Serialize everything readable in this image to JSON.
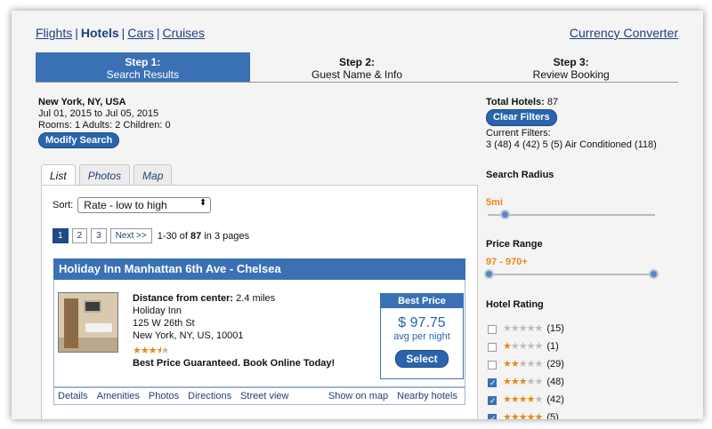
{
  "nav": {
    "flights": "Flights",
    "hotels": "Hotels",
    "cars": "Cars",
    "cruises": "Cruises",
    "separator": "|",
    "currency_converter": "Currency Converter"
  },
  "steps": [
    {
      "number": "Step 1:",
      "label": "Search Results"
    },
    {
      "number": "Step 2:",
      "label": "Guest Name & Info"
    },
    {
      "number": "Step 3:",
      "label": "Review Booking"
    }
  ],
  "search": {
    "city": "New York, NY, USA",
    "dates": "Jul 01, 2015 to Jul 05, 2015",
    "guests": "Rooms: 1 Adults: 2 Children: 0",
    "modify_label": "Modify Search"
  },
  "tabs": [
    "List",
    "Photos",
    "Map"
  ],
  "sort": {
    "label": "Sort:",
    "value": "Rate - low to high",
    "arrow": "⬍"
  },
  "pager": {
    "pages": [
      "1",
      "2",
      "3"
    ],
    "next_label": "Next >>",
    "summary_prefix": "1-30 of ",
    "total": "87",
    "summary_suffix": " in 3 pages"
  },
  "hotel": {
    "name": "Holiday Inn Manhattan 6th Ave - Chelsea",
    "distance_label": "Distance from center:",
    "distance_value": " 2.4 miles",
    "brand": "Holiday Inn",
    "street": "125 W 26th St",
    "citystate": "New York, NY, US, 10001",
    "stars": 3.5,
    "promo": "Best Price Guaranteed. Book Online Today!",
    "best_price_label": "Best Price",
    "price": "$ 97.75",
    "price_note": "avg per night",
    "select_label": "Select",
    "links": [
      "Details",
      "Amenities",
      "Photos",
      "Directions",
      "Street view"
    ],
    "map_links": [
      "Show on map",
      "Nearby hotels"
    ]
  },
  "filters": {
    "total_label": "Total Hotels:",
    "total_value": " 87",
    "clear_label": "Clear Filters",
    "current_label": "Current Filters:",
    "current_value": "3 (48) 4 (42) 5 (5) Air Conditioned (118)",
    "radius_title": "Search Radius",
    "radius_value": "5mi",
    "radius_fraction": 0.1,
    "price_title": "Price Range",
    "price_value": "97 - 970+",
    "price_range_fraction": [
      0.0,
      1.0
    ],
    "rating_title": "Hotel Rating",
    "ratings": [
      {
        "stars": 0,
        "count": "(15)",
        "checked": false
      },
      {
        "stars": 1,
        "count": "(1)",
        "checked": false
      },
      {
        "stars": 2,
        "count": "(29)",
        "checked": false
      },
      {
        "stars": 3,
        "count": "(48)",
        "checked": true
      },
      {
        "stars": 4,
        "count": "(42)",
        "checked": true
      },
      {
        "stars": 5,
        "count": "(5)",
        "checked": true
      }
    ]
  },
  "colors": {
    "accent": "#3a71b5",
    "star": "#e88a18",
    "link": "#1f3f7a"
  }
}
